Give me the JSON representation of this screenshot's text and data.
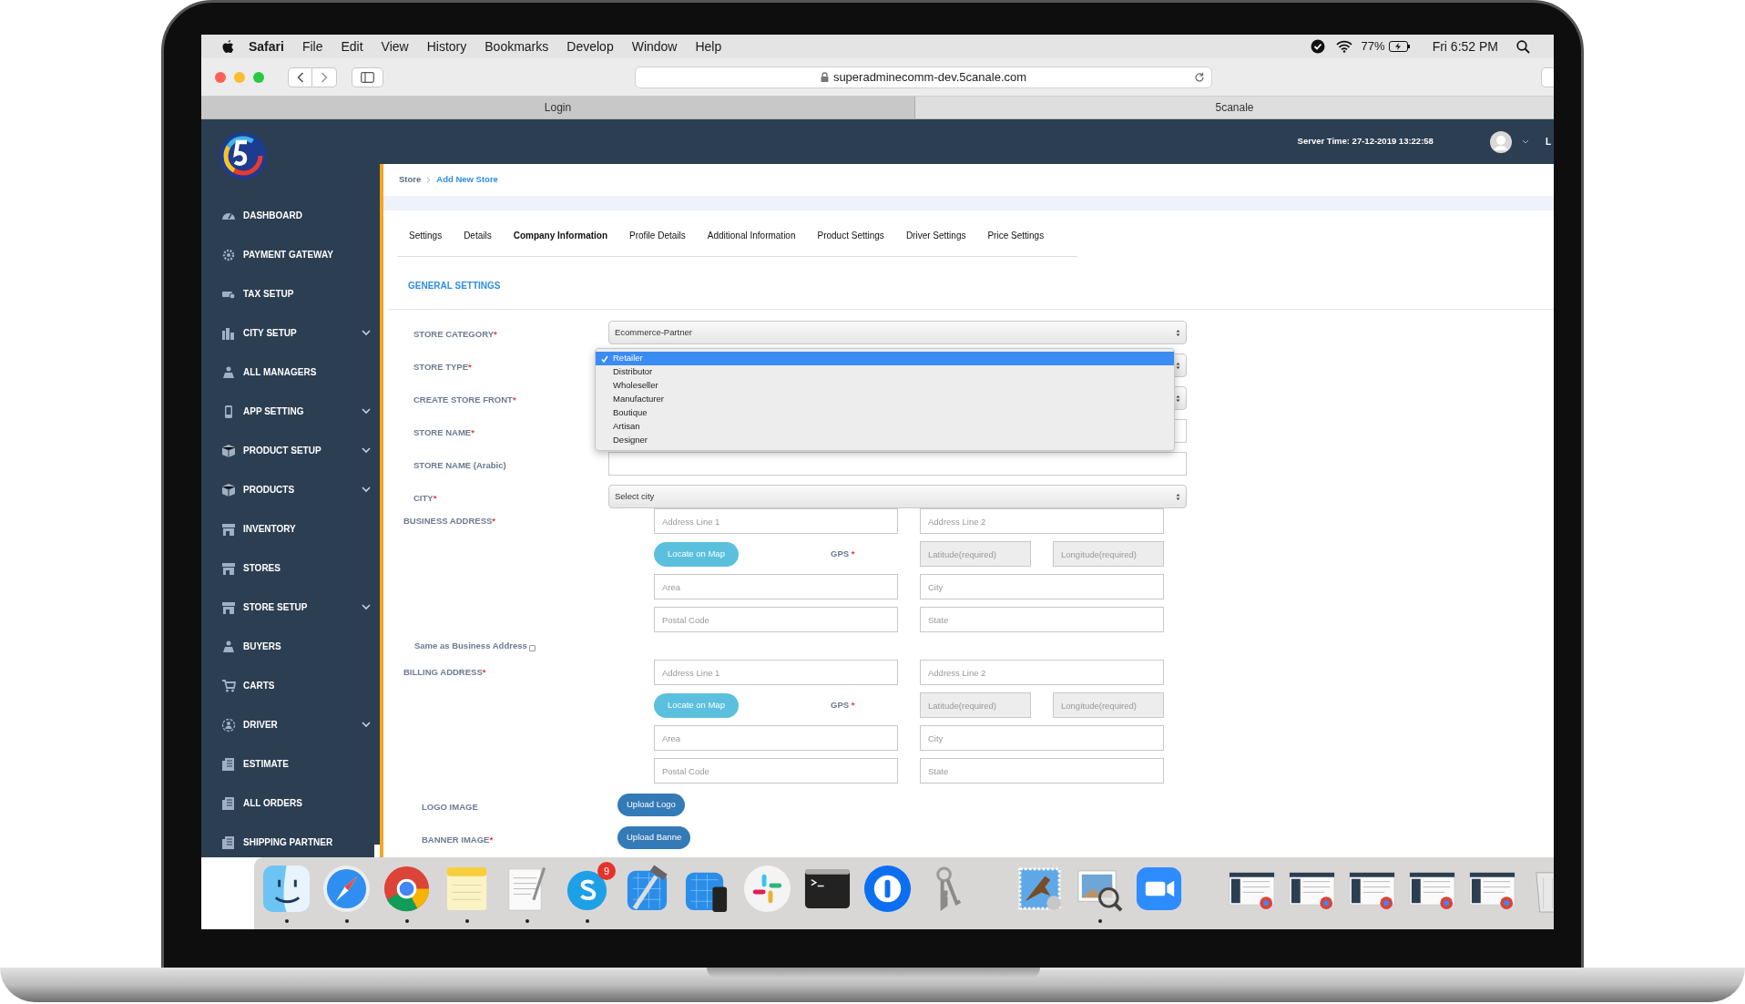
{
  "menu_bar": {
    "app": "Safari",
    "menus": [
      "File",
      "Edit",
      "View",
      "History",
      "Bookmarks",
      "Develop",
      "Window",
      "Help"
    ],
    "battery": "77%",
    "clock": "Fri 6:52 PM"
  },
  "browser": {
    "url": "superadminecomm-dev.5canale.com",
    "tabs": [
      {
        "label": "Login",
        "selected": false
      },
      {
        "label": "5canale",
        "selected": true
      }
    ]
  },
  "header": {
    "server_time": "Server Time: 27-12-2019 13:22:58",
    "user_label": "L"
  },
  "sidebar": {
    "items": [
      {
        "label": "DASHBOARD",
        "expandable": false
      },
      {
        "label": "PAYMENT GATEWAY",
        "expandable": false
      },
      {
        "label": "TAX SETUP",
        "expandable": false
      },
      {
        "label": "CITY SETUP",
        "expandable": true
      },
      {
        "label": "ALL MANAGERS",
        "expandable": false
      },
      {
        "label": "APP SETTING",
        "expandable": true
      },
      {
        "label": "PRODUCT SETUP",
        "expandable": true
      },
      {
        "label": "PRODUCTS",
        "expandable": true
      },
      {
        "label": "INVENTORY",
        "expandable": false
      },
      {
        "label": "STORES",
        "expandable": false
      },
      {
        "label": "STORE SETUP",
        "expandable": true
      },
      {
        "label": "BUYERS",
        "expandable": false
      },
      {
        "label": "CARTS",
        "expandable": false
      },
      {
        "label": "DRIVER",
        "expandable": true
      },
      {
        "label": "ESTIMATE",
        "expandable": false
      },
      {
        "label": "ALL ORDERS",
        "expandable": false
      },
      {
        "label": "SHIPPING PARTNER",
        "expandable": false
      }
    ]
  },
  "breadcrumb": [
    {
      "label": "Store",
      "current": false
    },
    {
      "label": "Add New Store",
      "current": true
    }
  ],
  "tabs": [
    {
      "label": "Settings",
      "selected": false
    },
    {
      "label": "Details",
      "selected": false
    },
    {
      "label": "Company Information",
      "selected": true
    },
    {
      "label": "Profile Details",
      "selected": false
    },
    {
      "label": "Additional Information",
      "selected": false
    },
    {
      "label": "Product Settings",
      "selected": false
    },
    {
      "label": "Driver Settings",
      "selected": false
    },
    {
      "label": "Price Settings",
      "selected": false
    }
  ],
  "section_title": "GENERAL SETTINGS",
  "fields": [
    {
      "label": "STORE CATEGORY",
      "required_mark": "*",
      "kind": "select",
      "value": "Ecommerce-Partner"
    },
    {
      "label": "STORE TYPE",
      "required_mark": "*",
      "kind": "select"
    },
    {
      "label": "CREATE STORE FRONT",
      "required_mark": "*",
      "kind": "select"
    },
    {
      "label": "STORE NAME",
      "required_mark": "*",
      "kind": "text"
    },
    {
      "label": "STORE NAME (Arabic)",
      "kind": "text"
    },
    {
      "label": "CITY",
      "required_mark": "*",
      "kind": "select",
      "value": "Select city"
    }
  ],
  "dropdown": {
    "options": [
      {
        "label": "Retailer",
        "selected": true
      },
      {
        "label": "Distributor",
        "selected": false
      },
      {
        "label": "Wholeseller",
        "selected": false
      },
      {
        "label": "Manufacturer",
        "selected": false
      },
      {
        "label": "Boutique",
        "selected": false
      },
      {
        "label": "Artisan",
        "selected": false
      },
      {
        "label": "Designer",
        "selected": false
      }
    ]
  },
  "business_address": {
    "label": "BUSINESS ADDRESS",
    "required_mark": "*",
    "locate_button": "Locate on Map",
    "gps_label": "GPS",
    "gps_mark": "*",
    "fields": [
      {
        "placeholder": "Address Line 1",
        "disabled": false
      },
      {
        "placeholder": "Address Line 2",
        "disabled": false
      },
      {
        "placeholder": "Latitude(required)",
        "disabled": true
      },
      {
        "placeholder": "Longitude(required)",
        "disabled": true
      },
      {
        "placeholder": "Area",
        "disabled": false
      },
      {
        "placeholder": "City",
        "disabled": false
      },
      {
        "placeholder": "Postal Code",
        "disabled": false
      },
      {
        "placeholder": "State",
        "disabled": false
      }
    ]
  },
  "same_as_business": {
    "label": "Same as Business Address",
    "checked": false
  },
  "billing_address": {
    "label": "BILLING ADDRESS",
    "required_mark": "*",
    "locate_button": "Locate on Map",
    "gps_label": "GPS",
    "gps_mark": "*",
    "fields": [
      {
        "placeholder": "Address Line 1",
        "disabled": false
      },
      {
        "placeholder": "Address Line 2",
        "disabled": false
      },
      {
        "placeholder": "Latitude(required)",
        "disabled": true
      },
      {
        "placeholder": "Longitude(required)",
        "disabled": true
      },
      {
        "placeholder": "Area",
        "disabled": false
      },
      {
        "placeholder": "City",
        "disabled": false
      },
      {
        "placeholder": "Postal Code",
        "disabled": false
      },
      {
        "placeholder": "State",
        "disabled": false
      }
    ]
  },
  "uploads": [
    {
      "label": "LOGO IMAGE",
      "button": "Upload Logo"
    },
    {
      "label": "BANNER IMAGE",
      "required_mark": "*",
      "button": "Upload Banne"
    }
  ],
  "dock": {
    "items": [
      {
        "kind": "app",
        "running": true
      },
      {
        "kind": "app",
        "running": true
      },
      {
        "kind": "app",
        "running": true
      },
      {
        "kind": "app",
        "running": true
      },
      {
        "kind": "app",
        "running": true
      },
      {
        "kind": "app",
        "running": true,
        "badge": "9"
      },
      {
        "kind": "app",
        "running": false
      },
      {
        "kind": "app",
        "running": false
      },
      {
        "kind": "app",
        "running": false
      },
      {
        "kind": "app",
        "running": false
      },
      {
        "kind": "app",
        "running": false
      },
      {
        "kind": "app",
        "running": false
      },
      {
        "kind": "separator"
      },
      {
        "kind": "app",
        "running": false
      },
      {
        "kind": "app",
        "running": true
      },
      {
        "kind": "app",
        "running": false
      },
      {
        "kind": "separator"
      },
      {
        "kind": "window"
      },
      {
        "kind": "window"
      },
      {
        "kind": "window"
      },
      {
        "kind": "window"
      },
      {
        "kind": "window"
      },
      {
        "kind": "trash"
      }
    ]
  }
}
